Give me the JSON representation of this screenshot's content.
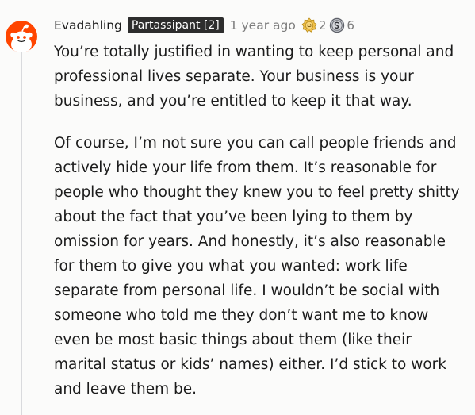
{
  "comment": {
    "author": "Evadahling",
    "flair": "Partassipant [2]",
    "timestamp": "1 year ago",
    "awards": [
      {
        "icon": "gold-badge-icon",
        "count": "2"
      },
      {
        "icon": "silver-coin-icon",
        "count": "6"
      }
    ],
    "avatar": {
      "icon": "reddit-snoo-icon",
      "color": "#ff4500"
    },
    "paragraphs": [
      "You’re totally justified in wanting to keep personal and professional lives separate. Your business is your business, and you’re entitled to keep it that way.",
      "Of course, I’m not sure you can call people friends and actively hide your life from them. It’s reasonable for people who thought they knew you to feel pretty shitty about the fact that you’ve been lying to them by omission for years. And honestly, it’s also reasonable for them to give you what you wanted: work life separate from personal life. I wouldn’t be social with someone who told me they don’t want me to know even be most basic things about them (like their marital status or kids’ names) either. I’d stick to work and leave them be."
    ]
  },
  "colors": {
    "avatar_bg": "#ff4500",
    "flair_bg": "#2d2d2d",
    "meta_text": "#7c7c7c",
    "thread_line": "#d9dadd"
  }
}
